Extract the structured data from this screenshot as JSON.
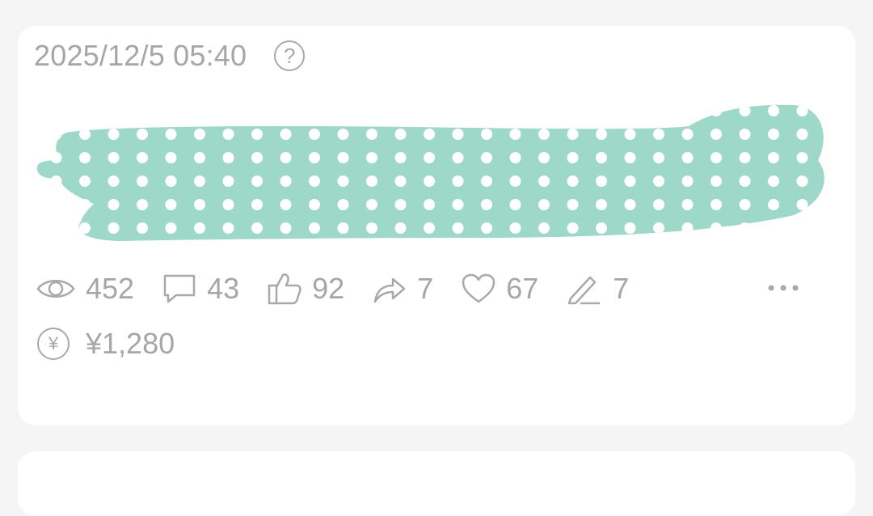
{
  "post": {
    "timestamp": "2025/12/5 05:40",
    "help_glyph": "?",
    "redaction_color": "#9dd8c8",
    "stats": [
      {
        "icon": "eye-icon",
        "value": "452"
      },
      {
        "icon": "comment-icon",
        "value": "43"
      },
      {
        "icon": "thumbs-up-icon",
        "value": "92"
      },
      {
        "icon": "share-icon",
        "value": "7"
      },
      {
        "icon": "heart-icon",
        "value": "67"
      },
      {
        "icon": "pen-icon",
        "value": "7"
      }
    ],
    "earnings_glyph": "¥",
    "earnings": "¥1,280"
  },
  "colors": {
    "background": "#f4f5f4",
    "card": "#ffffff",
    "text_muted": "#a6a6a6"
  }
}
